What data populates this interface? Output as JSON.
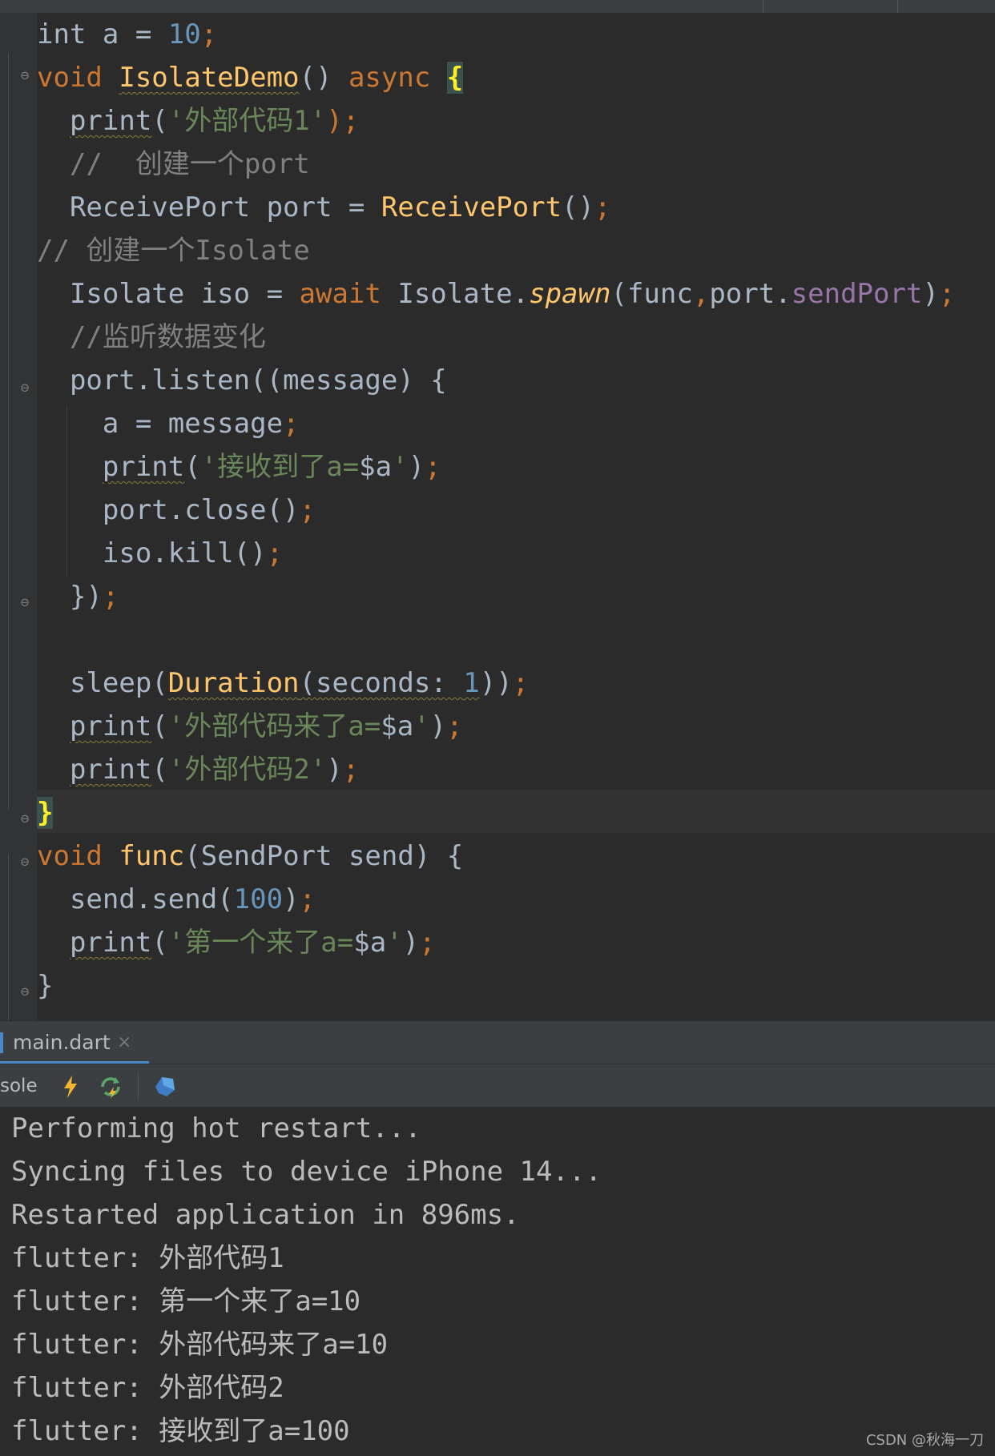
{
  "editor": {
    "lines": [
      [
        {
          "t": "int a = ",
          "c": ""
        },
        {
          "t": "10",
          "c": "num"
        },
        {
          "t": ";",
          "c": "semi"
        }
      ],
      [
        {
          "t": "void ",
          "c": "kw"
        },
        {
          "t": "IsolateDemo",
          "c": "fn warn"
        },
        {
          "t": "() ",
          "c": ""
        },
        {
          "t": "async ",
          "c": "kw"
        },
        {
          "t": "{",
          "c": "brace-hl"
        }
      ],
      [
        {
          "t": "  ",
          "c": ""
        },
        {
          "t": "print",
          "c": "warn"
        },
        {
          "t": "(",
          "c": ""
        },
        {
          "t": "'外部代码1'",
          "c": "str"
        },
        {
          "t": ");",
          "c": "semi"
        }
      ],
      [
        {
          "t": "  //  创建一个port",
          "c": "cmt"
        }
      ],
      [
        {
          "t": "  ReceivePort port = ",
          "c": ""
        },
        {
          "t": "ReceivePort",
          "c": "fn"
        },
        {
          "t": "()",
          "c": ""
        },
        {
          "t": ";",
          "c": "semi"
        }
      ],
      [
        {
          "t": "// 创建一个Isolate",
          "c": "cmt"
        }
      ],
      [
        {
          "t": "  Isolate iso = ",
          "c": ""
        },
        {
          "t": "await ",
          "c": "kw"
        },
        {
          "t": "Isolate.",
          "c": ""
        },
        {
          "t": "spawn",
          "c": "italic-fn"
        },
        {
          "t": "(func",
          "c": ""
        },
        {
          "t": ",",
          "c": "semi"
        },
        {
          "t": "port.",
          "c": ""
        },
        {
          "t": "sendPort",
          "c": "prop"
        },
        {
          "t": ")",
          "c": ""
        },
        {
          "t": ";",
          "c": "semi"
        }
      ],
      [
        {
          "t": "  //监听数据变化",
          "c": "cmt"
        }
      ],
      [
        {
          "t": "  port.listen((message) {",
          "c": ""
        }
      ],
      [
        {
          "t": "    a = message",
          "c": ""
        },
        {
          "t": ";",
          "c": "semi"
        }
      ],
      [
        {
          "t": "    ",
          "c": ""
        },
        {
          "t": "print",
          "c": "warn"
        },
        {
          "t": "(",
          "c": ""
        },
        {
          "t": "'接收到了a=",
          "c": "str"
        },
        {
          "t": "$a",
          "c": ""
        },
        {
          "t": "'",
          "c": "str"
        },
        {
          "t": ")",
          "c": ""
        },
        {
          "t": ";",
          "c": "semi"
        }
      ],
      [
        {
          "t": "    port.close()",
          "c": ""
        },
        {
          "t": ";",
          "c": "semi"
        }
      ],
      [
        {
          "t": "    iso.kill()",
          "c": ""
        },
        {
          "t": ";",
          "c": "semi"
        }
      ],
      [
        {
          "t": "  })",
          "c": ""
        },
        {
          "t": ";",
          "c": "semi"
        }
      ],
      [
        {
          "t": "",
          "c": ""
        }
      ],
      [
        {
          "t": "  sleep(",
          "c": ""
        },
        {
          "t": "Duration",
          "c": "fn warn"
        },
        {
          "t": "(seconds: ",
          "c": "warn"
        },
        {
          "t": "1",
          "c": "num warn"
        },
        {
          "t": "))",
          "c": ""
        },
        {
          "t": ";",
          "c": "semi"
        }
      ],
      [
        {
          "t": "  ",
          "c": ""
        },
        {
          "t": "print",
          "c": "warn"
        },
        {
          "t": "(",
          "c": ""
        },
        {
          "t": "'外部代码来了a=",
          "c": "str"
        },
        {
          "t": "$a",
          "c": ""
        },
        {
          "t": "'",
          "c": "str"
        },
        {
          "t": ")",
          "c": ""
        },
        {
          "t": ";",
          "c": "semi"
        }
      ],
      [
        {
          "t": "  ",
          "c": ""
        },
        {
          "t": "print",
          "c": "warn"
        },
        {
          "t": "(",
          "c": ""
        },
        {
          "t": "'外部代码2'",
          "c": "str"
        },
        {
          "t": ")",
          "c": ""
        },
        {
          "t": ";",
          "c": "semi"
        }
      ],
      [
        {
          "t": "}",
          "c": "brace-hl"
        }
      ],
      [
        {
          "t": "void ",
          "c": "kw"
        },
        {
          "t": "func",
          "c": "fn"
        },
        {
          "t": "(SendPort send) {",
          "c": ""
        }
      ],
      [
        {
          "t": "  send.send(",
          "c": ""
        },
        {
          "t": "100",
          "c": "num"
        },
        {
          "t": ")",
          "c": ""
        },
        {
          "t": ";",
          "c": "semi"
        }
      ],
      [
        {
          "t": "  ",
          "c": ""
        },
        {
          "t": "print",
          "c": "warn"
        },
        {
          "t": "(",
          "c": ""
        },
        {
          "t": "'第一个来了a=",
          "c": "str"
        },
        {
          "t": "$a",
          "c": ""
        },
        {
          "t": "'",
          "c": "str"
        },
        {
          "t": ")",
          "c": ""
        },
        {
          "t": ";",
          "c": "semi"
        }
      ],
      [
        {
          "t": "}",
          "c": ""
        }
      ]
    ]
  },
  "tab": {
    "label": "main.dart",
    "close": "×"
  },
  "toolbar": {
    "label": "sole",
    "icons": [
      "hot-reload-icon",
      "hot-restart-icon",
      "dart-devtools-icon"
    ]
  },
  "console": {
    "lines": [
      "Performing hot restart...",
      "Syncing files to device iPhone 14...",
      "Restarted application in 896ms.",
      "flutter: 外部代码1",
      "flutter: 第一个来了a=10",
      "flutter: 外部代码来了a=10",
      "flutter: 外部代码2",
      "flutter: 接收到了a=100"
    ]
  },
  "watermark": "CSDN @秋海一刀",
  "colors": {
    "background": "#2b2b2b",
    "keyword": "#cc7832",
    "number": "#6897bb",
    "string": "#6a8759",
    "comment": "#808080",
    "function": "#ffc66d",
    "property": "#9876aa",
    "text": "#a9b7c6"
  }
}
